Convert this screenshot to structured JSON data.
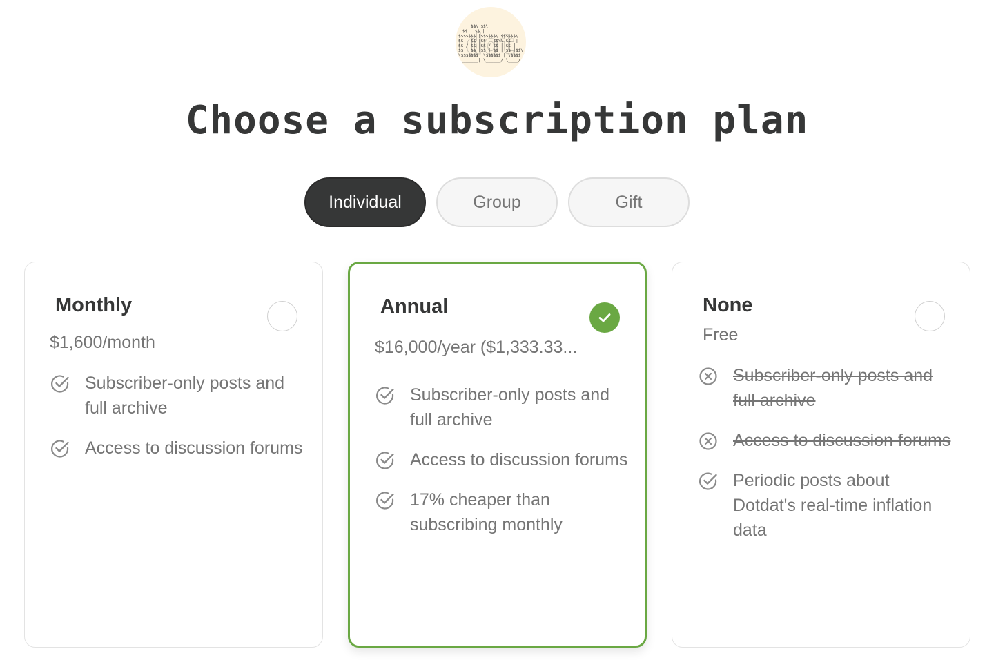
{
  "logo": {
    "text": "dot",
    "name": "publication-logo"
  },
  "title": "Choose a subscription plan",
  "tabs": [
    {
      "label": "Individual",
      "active": true
    },
    {
      "label": "Group",
      "active": false
    },
    {
      "label": "Gift",
      "active": false
    }
  ],
  "plans": [
    {
      "name": "Monthly",
      "price": "$1,600/month",
      "selected": false,
      "features": [
        {
          "text": "Subscriber-only posts and full archive",
          "included": true
        },
        {
          "text": "Access to discussion forums",
          "included": true
        }
      ]
    },
    {
      "name": "Annual",
      "price": "$16,000/year ($1,333.33...",
      "selected": true,
      "features": [
        {
          "text": "Subscriber-only posts and full archive",
          "included": true
        },
        {
          "text": "Access to discussion forums",
          "included": true
        },
        {
          "text": "17% cheaper than subscribing monthly",
          "included": true
        }
      ]
    },
    {
      "name": "None",
      "price": "Free",
      "selected": false,
      "features": [
        {
          "text": "Subscriber-only posts and full archive",
          "included": false
        },
        {
          "text": "Access to discussion forums",
          "included": false
        },
        {
          "text": "Periodic posts about Dotdat's real-time inflation data",
          "included": true
        }
      ]
    }
  ],
  "colors": {
    "accent": "#6aa843",
    "dark": "#363737",
    "muted": "#757575",
    "logo_bg": "#fdf3df"
  },
  "icons": {
    "included": "check-circle-icon",
    "excluded": "x-circle-icon",
    "selected": "checkmark-icon"
  }
}
